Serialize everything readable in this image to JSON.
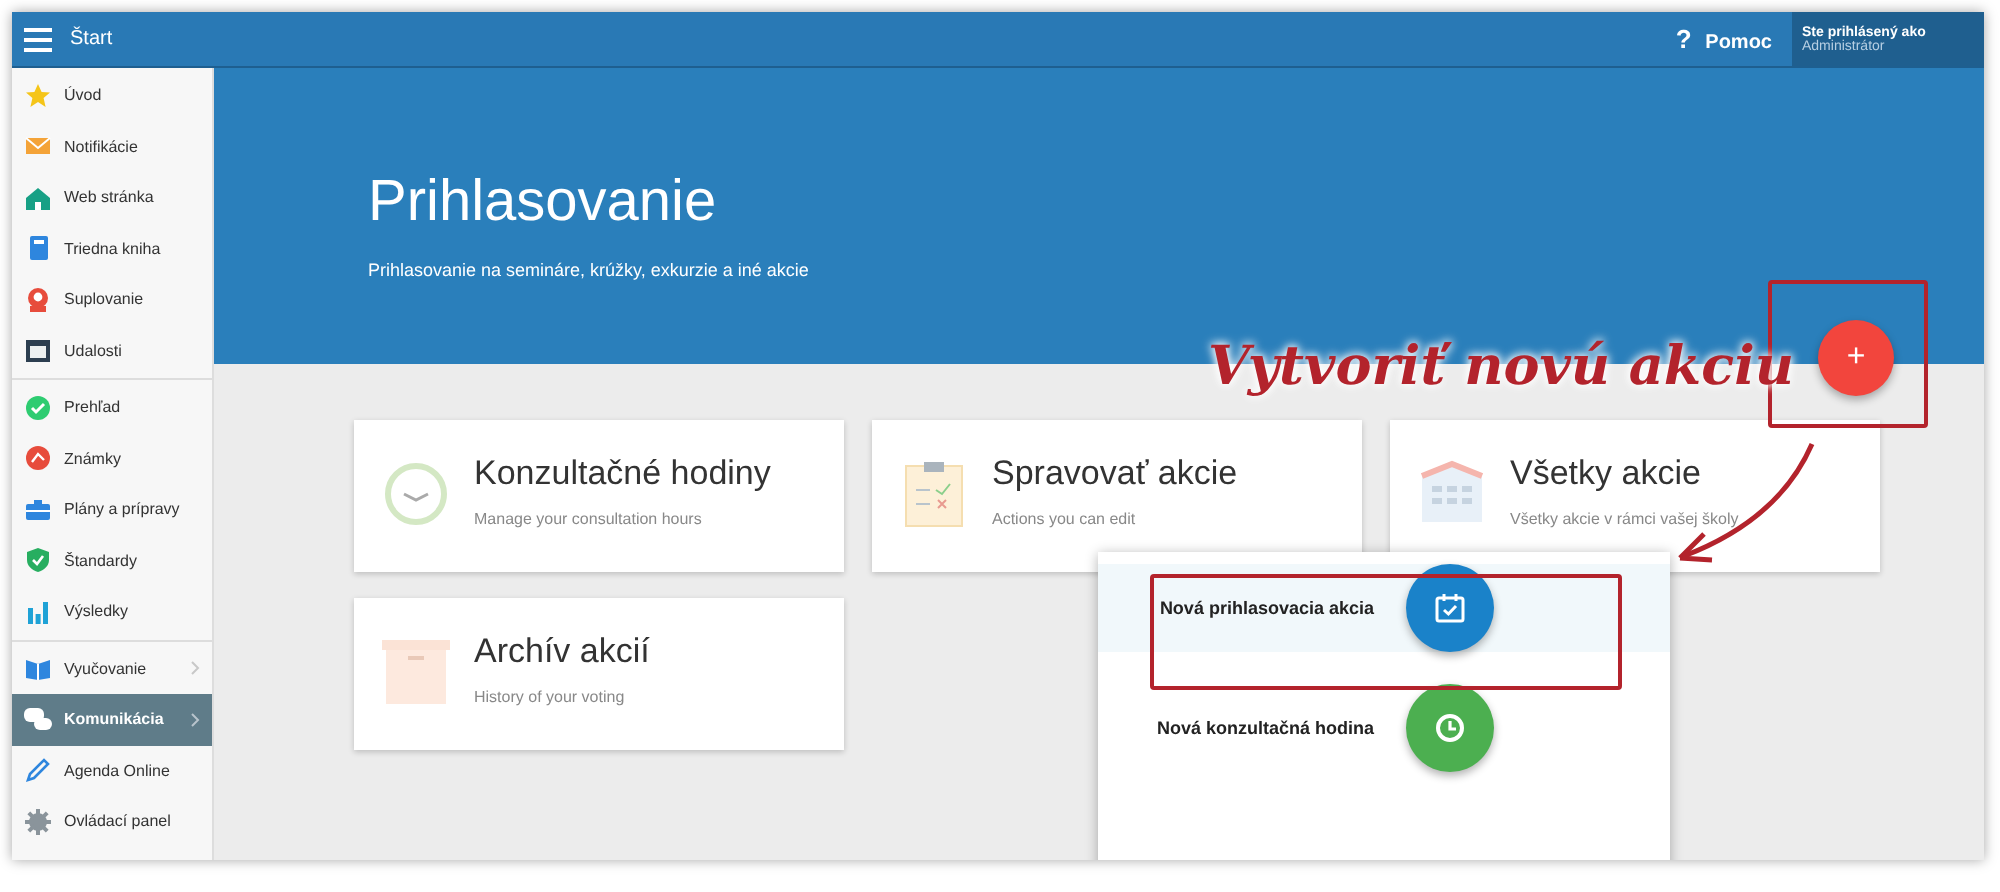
{
  "topbar": {
    "menu_icon_label": "Štart",
    "help": {
      "icon": "?",
      "label": "Pomoc"
    },
    "user": {
      "caption": "Ste prihlásený ako",
      "name": "Administrátor"
    }
  },
  "sidebar": {
    "groups": [
      {
        "items": [
          {
            "label": "Úvod",
            "selected": false,
            "expandable": false
          },
          {
            "label": "Notifikácie",
            "selected": false,
            "expandable": false
          },
          {
            "label": "Web stránka",
            "selected": false,
            "expandable": false
          },
          {
            "label": "Triedna kniha",
            "selected": false,
            "expandable": false
          },
          {
            "label": "Suplovanie",
            "selected": false,
            "expandable": false
          },
          {
            "label": "Udalosti",
            "selected": false,
            "expandable": false
          }
        ]
      },
      {
        "items": [
          {
            "label": "Prehľad",
            "selected": false,
            "expandable": false
          },
          {
            "label": "Známky",
            "selected": false,
            "expandable": false
          },
          {
            "label": "Plány a prípravy",
            "selected": false,
            "expandable": false
          },
          {
            "label": "Štandardy",
            "selected": false,
            "expandable": false
          },
          {
            "label": "Výsledky",
            "selected": false,
            "expandable": false
          }
        ]
      },
      {
        "items": [
          {
            "label": "Vyučovanie",
            "selected": false,
            "expandable": true
          },
          {
            "label": "Komunikácia",
            "selected": true,
            "expandable": true
          },
          {
            "label": "Agenda Online",
            "selected": false,
            "expandable": false
          },
          {
            "label": "Ovládací panel",
            "selected": false,
            "expandable": false
          }
        ]
      }
    ]
  },
  "hero": {
    "title": "Prihlasovanie",
    "subtitle": "Prihlasovanie na semináre, krúžky, exkurzie a iné akcie"
  },
  "add_button": {
    "label": "+"
  },
  "cards": [
    {
      "title": "Konzultačné hodiny",
      "subtitle": "Manage your consultation hours"
    },
    {
      "title": "Spravovať akcie",
      "subtitle": "Actions you can edit"
    },
    {
      "title": "Všetky akcie",
      "subtitle": "Všetky akcie v rámci vašej školy"
    },
    {
      "title": "Archív akcií",
      "subtitle": "History of your voting"
    }
  ],
  "popup_menu": {
    "items": [
      {
        "label": "Nová prihlasovacia akcia",
        "selected": true,
        "kind": "event"
      },
      {
        "label": "Nová konzultačná hodina",
        "selected": false,
        "kind": "hour"
      }
    ]
  },
  "annotation": {
    "text": "Vytvoriť novú akciu"
  }
}
